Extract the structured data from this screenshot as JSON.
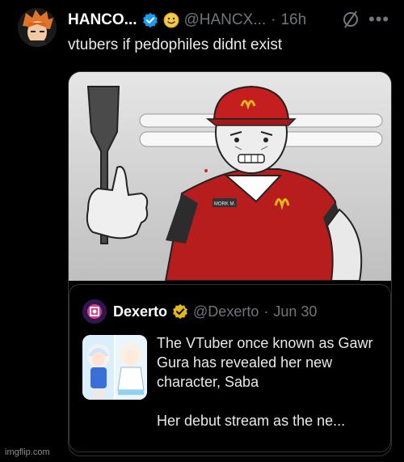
{
  "tweet": {
    "display_name": "HANCO...",
    "handle": "@HANCX...",
    "separator": "·",
    "time": "16h",
    "text": "vtubers if pedophiles didnt exist",
    "icons": [
      "verified-badge-icon",
      "smiley-icon",
      "edit-slash-icon",
      "more-icon"
    ]
  },
  "media": {
    "shirt_tag": "MORK M."
  },
  "quote": {
    "display_name": "Dexerto",
    "handle": "@Dexerto",
    "separator": "·",
    "time": "Jun 30",
    "text_line1": "The VTuber once known as Gawr Gura has revealed her new character, Saba",
    "text_line2": "Her debut stream as the ne..."
  },
  "watermark": "imgflip.com",
  "colors": {
    "verified": "#1d9bf0",
    "gold": "#e2b719",
    "mcd_red": "#c41e1e"
  }
}
